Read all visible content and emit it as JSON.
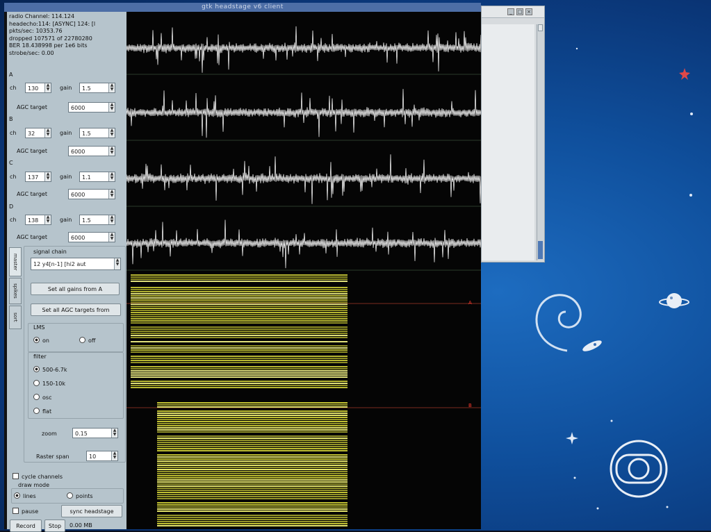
{
  "window": {
    "title": "gtk headstage v6 client"
  },
  "status": {
    "radio_channel": "radio Channel: 114.124",
    "headecho": "headecho:114: [ASYNC] 124: [l",
    "pkts": "pkts/sec: 10353.76",
    "dropped": "dropped 107571 of 22780280",
    "ber": "BER 18.438998 per 1e6 bits",
    "strobe": "strobe/sec: 0.00"
  },
  "channels": [
    {
      "letter": "A",
      "ch_label": "ch",
      "ch_value": "130",
      "gain_label": "gain",
      "gain_value": "1.5",
      "agc_label": "AGC target",
      "agc_value": "6000"
    },
    {
      "letter": "B",
      "ch_label": "ch",
      "ch_value": "32",
      "gain_label": "gain",
      "gain_value": "1.5",
      "agc_label": "AGC target",
      "agc_value": "6000"
    },
    {
      "letter": "C",
      "ch_label": "ch",
      "ch_value": "137",
      "gain_label": "gain",
      "gain_value": "1.1",
      "agc_label": "AGC target",
      "agc_value": "6000"
    },
    {
      "letter": "D",
      "ch_label": "ch",
      "ch_value": "138",
      "gain_label": "gain",
      "gain_value": "1.5",
      "agc_label": "AGC target",
      "agc_value": "6000"
    }
  ],
  "tabs": [
    {
      "label": "master"
    },
    {
      "label": "spikes"
    },
    {
      "label": "sort"
    }
  ],
  "signal_chain": {
    "label": "signal chain",
    "selected": "12    y4[n-1] [hi2 aut",
    "set_gains_button": "Set all gains from A",
    "set_agc_button": "Set all AGC targets from"
  },
  "lms": {
    "label": "LMS",
    "options": [
      {
        "label": "on",
        "selected": true
      },
      {
        "label": "off",
        "selected": false
      }
    ]
  },
  "filter": {
    "label": "filter",
    "options": [
      {
        "label": "500-6.7k",
        "selected": true
      },
      {
        "label": "150-10k",
        "selected": false
      },
      {
        "label": "osc",
        "selected": false
      },
      {
        "label": "flat",
        "selected": false
      }
    ]
  },
  "zoom": {
    "label": "zoom",
    "value": "0.15"
  },
  "raster_span": {
    "label": "Raster span",
    "value": "10"
  },
  "cycle_channels": {
    "label": "cycle channels"
  },
  "draw_mode": {
    "label": "draw mode",
    "options": [
      {
        "label": "lines",
        "selected": true
      },
      {
        "label": "points",
        "selected": false
      }
    ]
  },
  "pause": {
    "label": "pause"
  },
  "sync_button": "sync headstage",
  "record_button": "Record",
  "stop_button": "Stop",
  "size_readout": "0.00 MB",
  "plot_labels": {
    "a": "A",
    "b": "B"
  },
  "side_window": {
    "buttons": [
      "_",
      "□",
      "×"
    ]
  },
  "colors": {
    "panel": "#b6c4cc",
    "trace": "#ffffff",
    "raster": "#c8c832",
    "desktop": "#0f4f9c",
    "title": "#4d6ea6"
  },
  "desktop_icons": [
    "debian-swirl-icon",
    "planet-icon",
    "rocket-icon",
    "globo-logo-icon",
    "star-icon"
  ]
}
